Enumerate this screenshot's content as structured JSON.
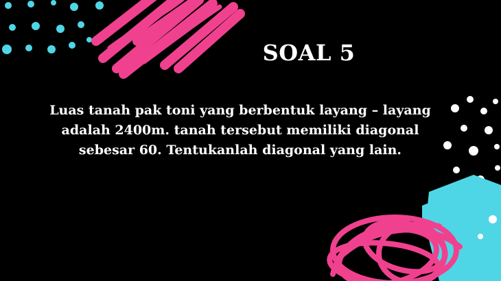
{
  "slide": {
    "title": "SOAL 5",
    "body_lines": [
      "Luas tanah pak toni yang berbentuk layang – layang",
      "adalah 2400m. tanah tersebut memiliki diagonal",
      "sebesar 60. Tentukanlah diagonal yang lain."
    ]
  },
  "colors": {
    "background": "#000000",
    "text": "#ffffff",
    "accent_pink": "#f0418f",
    "accent_cyan": "#4fd6e6"
  }
}
